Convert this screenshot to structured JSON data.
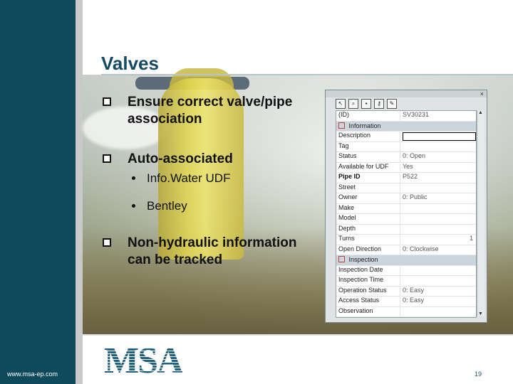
{
  "slide": {
    "title": "Valves",
    "bullets": [
      {
        "line1": "Ensure correct valve/pipe",
        "line2": "association"
      },
      {
        "line1": "Auto-associated",
        "line2": ""
      },
      {
        "line1": "Non-hydraulic information",
        "line2": "can be tracked"
      }
    ],
    "sub_bullets": [
      "Info.Water UDF",
      "Bentley"
    ],
    "website": "www.msa-ep.com",
    "page_number": "19",
    "logo_text": "MSA"
  },
  "panel": {
    "close_glyph": "×",
    "id_label": "(ID)",
    "id_value": "SV30231",
    "information_group": "Information",
    "inspection_group": "Inspection",
    "rows": [
      {
        "label": "Description",
        "value": ""
      },
      {
        "label": "Tag",
        "value": ""
      },
      {
        "label": "Status",
        "value": "0: Open"
      },
      {
        "label": "Available for UDF",
        "value": "Yes"
      },
      {
        "label": "Pipe ID",
        "value": "P522"
      },
      {
        "label": "Street",
        "value": ""
      },
      {
        "label": "Owner",
        "value": "0: Public"
      },
      {
        "label": "Make",
        "value": ""
      },
      {
        "label": "Model",
        "value": ""
      },
      {
        "label": "Depth",
        "value": ""
      },
      {
        "label": "Turns",
        "value": "1"
      },
      {
        "label": "Open Direction",
        "value": "0: Clockwise"
      }
    ],
    "inspection_rows": [
      {
        "label": "Inspection Date",
        "value": ""
      },
      {
        "label": "Inspection Time",
        "value": ""
      },
      {
        "label": "Operation Status",
        "value": "0: Easy"
      },
      {
        "label": "Access Status",
        "value": "0: Easy"
      },
      {
        "label": "Observation",
        "value": ""
      }
    ]
  }
}
